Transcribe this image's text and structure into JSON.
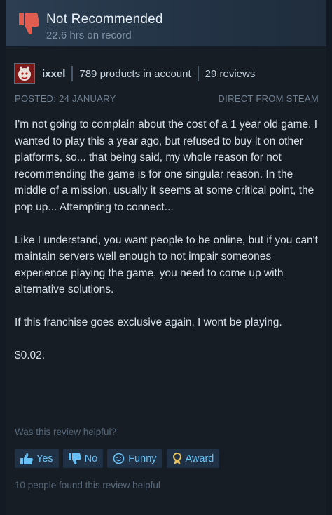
{
  "review": {
    "verdict": "Not Recommended",
    "hours": "22.6 hrs on record",
    "author": {
      "name": "ixxel",
      "products": "789 products in account",
      "reviews": "29 reviews"
    },
    "posted": "POSTED: 24 JANUARY",
    "source": "DIRECT FROM STEAM",
    "paragraphs": [
      "I'm not going to complain about the cost of a 1 year old game. I wanted to play this a year ago, but refused to buy it on other platforms, so... that being said, my whole reason for not recommending the game is for one singular reason. In the middle of a mission, usually it seems at some critical point, the pop up... Attempting to connect...",
      "Like I understand, you want people to be online, but if you can't maintain servers well enough to not impair someones experience playing the game, you need to come up with alternative solutions.",
      "If this franchise goes exclusive again, I wont be playing.",
      "$0.02."
    ],
    "helpful_question": "Was this review helpful?",
    "buttons": {
      "yes": "Yes",
      "no": "No",
      "funny": "Funny",
      "award": "Award"
    },
    "helpful_count": "10 people found this review helpful"
  },
  "colors": {
    "accent": "#67c1f5",
    "thumb_down": "#e05d4f",
    "award": "#e8c15a"
  }
}
